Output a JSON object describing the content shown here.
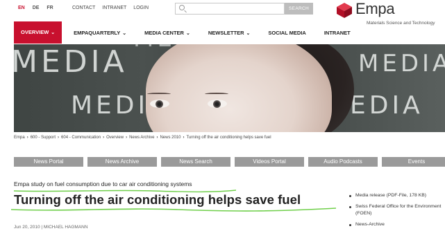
{
  "languages": [
    {
      "label": "EN",
      "active": true
    },
    {
      "label": "DE",
      "active": false
    },
    {
      "label": "FR",
      "active": false
    }
  ],
  "utility_links": [
    "CONTACT",
    "INTRANET",
    "LOGIN"
  ],
  "search": {
    "placeholder": "",
    "button": "SEARCH",
    "icon": "search-icon"
  },
  "logo": {
    "word": "Empa",
    "tagline": "Materials Science and Technology",
    "color": "#c8102e"
  },
  "nav": [
    {
      "label": "OVERVIEW",
      "chevron": true,
      "active": true
    },
    {
      "label": "EMPAQUARTERLY",
      "chevron": true,
      "active": false
    },
    {
      "label": "MEDIA CENTER",
      "chevron": true,
      "active": false
    },
    {
      "label": "NEWSLETTER",
      "chevron": true,
      "active": false
    },
    {
      "label": "SOCIAL MEDIA",
      "chevron": false,
      "active": false
    },
    {
      "label": "INTRANET",
      "chevron": false,
      "active": false
    }
  ],
  "hero": {
    "chalk_words": [
      "MEDIA",
      "MEDIA",
      "ME",
      "MEDIA",
      "MEDIA"
    ]
  },
  "breadcrumb": [
    "Empa",
    "600 - Support",
    "604 - Communication",
    "Overview",
    "News Archive",
    "News 2010",
    "Turning off the air conditioning helps save fuel"
  ],
  "tabs": [
    "News Portal",
    "News Archive",
    "News Search",
    "Videos Portal",
    "Audio Podcasts",
    "Events"
  ],
  "article": {
    "kicker": "Empa study on fuel consumption due to car air conditioning systems",
    "headline": "Turning off the air conditioning helps save fuel",
    "byline": "Jun 20, 2010 | MICHAEL HAGMANN"
  },
  "sidebar": [
    {
      "line1": "Media release (PDF-File, 178 KB)",
      "line2": ""
    },
    {
      "line1": "Swiss Federal Office for the Environment",
      "line2": "(FOEN)"
    },
    {
      "line1": "News-Archive",
      "line2": ""
    }
  ],
  "colors": {
    "accent": "#c8102e",
    "tab_bg": "#9a9a9a",
    "highlight": "#6fcf4a"
  }
}
